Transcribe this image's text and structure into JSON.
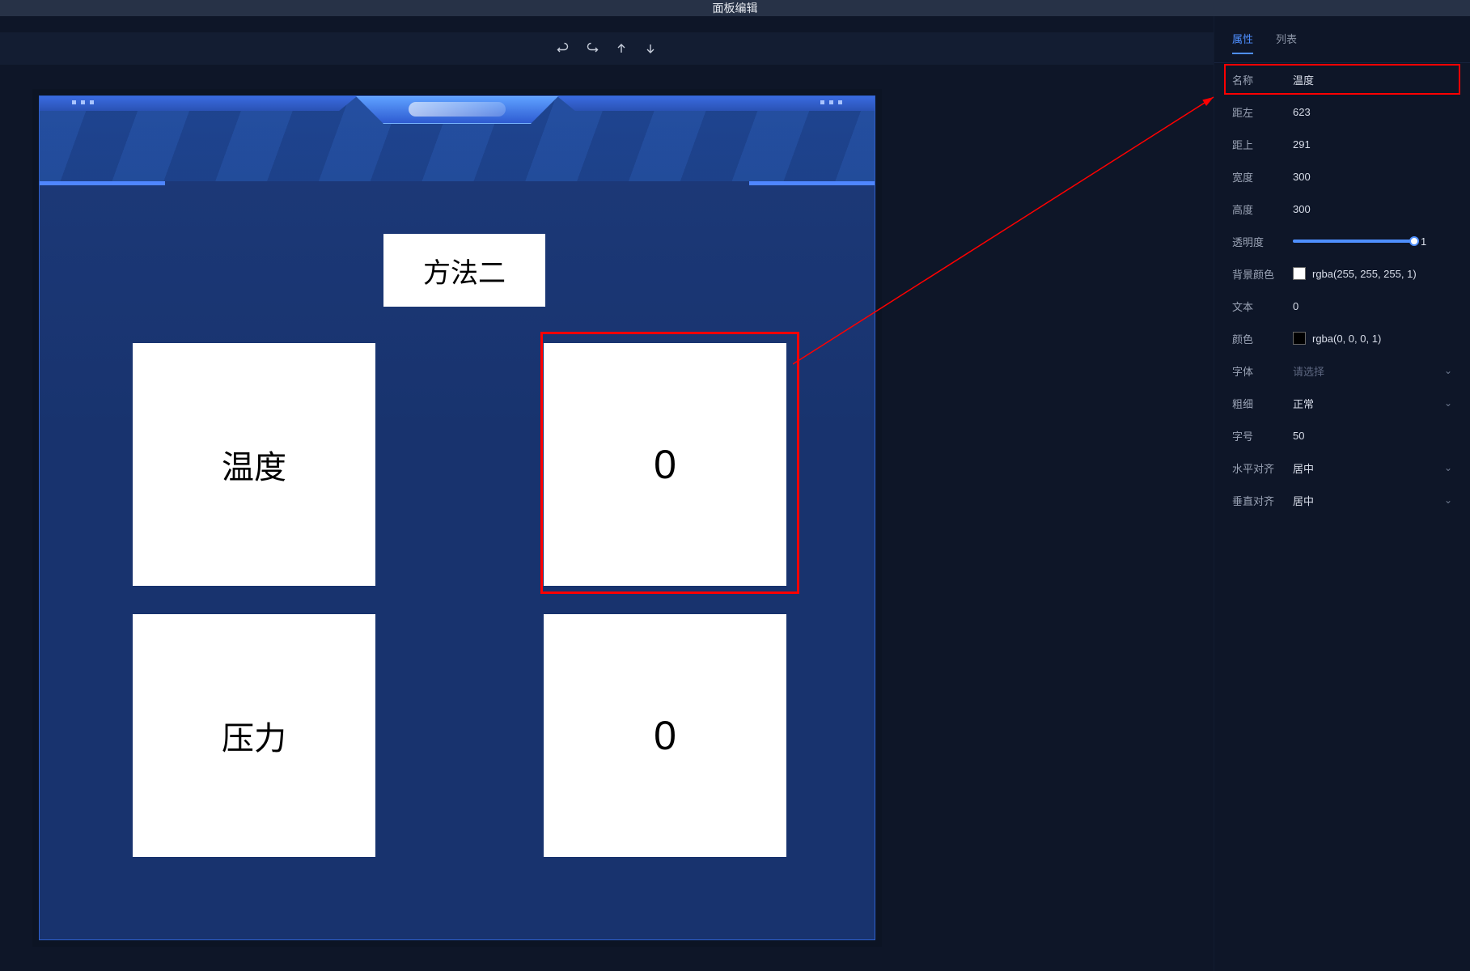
{
  "title": "面板编辑",
  "tabs": {
    "props": "属性",
    "list": "列表"
  },
  "canvas": {
    "header": "方法二",
    "blocks": {
      "temp_label": "温度",
      "temp_value": "0",
      "press_label": "压力",
      "press_value": "0"
    }
  },
  "props": {
    "name_label": "名称",
    "name_value": "温度",
    "left_label": "距左",
    "left_value": "623",
    "top_label": "距上",
    "top_value": "291",
    "width_label": "宽度",
    "width_value": "300",
    "height_label": "高度",
    "height_value": "300",
    "opacity_label": "透明度",
    "opacity_value": "1",
    "bg_label": "背景颜色",
    "bg_value": "rgba(255, 255, 255, 1)",
    "text_label": "文本",
    "text_value": "0",
    "color_label": "颜色",
    "color_value": "rgba(0, 0, 0, 1)",
    "font_label": "字体",
    "font_placeholder": "请选择",
    "weight_label": "粗细",
    "weight_value": "正常",
    "size_label": "字号",
    "size_value": "50",
    "halign_label": "水平对齐",
    "halign_value": "居中",
    "valign_label": "垂直对齐",
    "valign_value": "居中"
  }
}
